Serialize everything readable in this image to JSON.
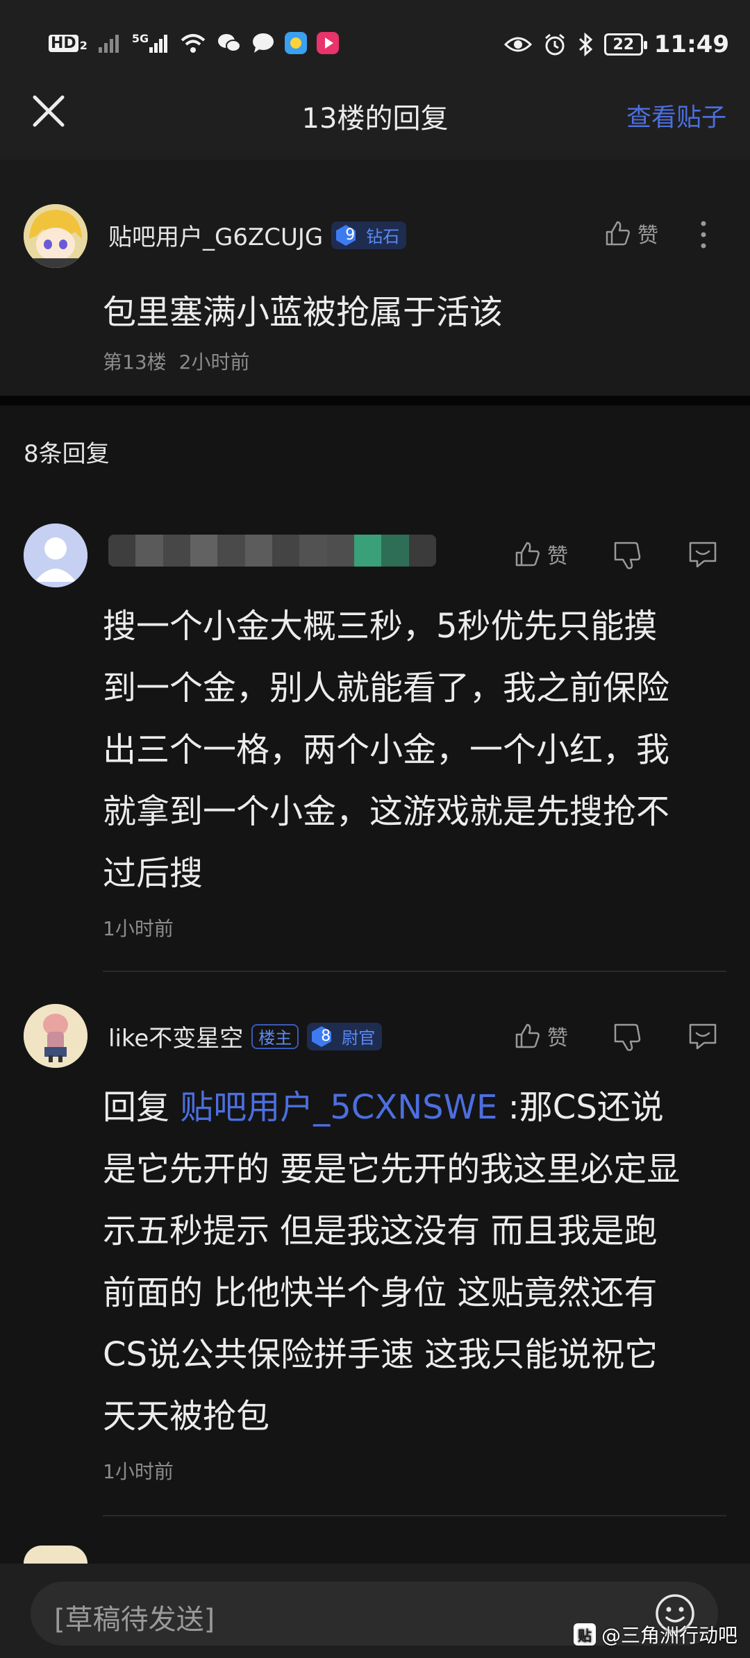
{
  "status_bar": {
    "hd_label": "HD",
    "hd_sub": "2",
    "net_label": "5G",
    "time": "11:49",
    "battery": "22"
  },
  "header": {
    "title": "13楼的回复",
    "view_post": "查看贴子"
  },
  "floor": {
    "username": "贴吧用户_G6ZCUJG",
    "level": "9",
    "level_title": "钻石",
    "like_label": "赞",
    "content": "包里塞满小蓝被抢属于活该",
    "floor_no": "第13楼",
    "time": "2小时前"
  },
  "replies_header": "8条回复",
  "replies": [
    {
      "username": "",
      "like_label": "赞",
      "lines": [
        "搜一个小金大概三秒，5秒优先只能摸",
        "到一个金，别人就能看了，我之前保险",
        "出三个一格，两个小金，一个小红，我",
        "就拿到一个小金，这游戏就是先搜抢不",
        "过后搜"
      ],
      "time": "1小时前"
    },
    {
      "username": "like不变星空",
      "owner_badge": "楼主",
      "level": "8",
      "level_title": "尉官",
      "like_label": "赞",
      "reply_prefix": "回复 ",
      "mention": "贴吧用户_5CXNSWE",
      "first_line_rest": " :那CS还说",
      "lines": [
        "是它先开的 要是它先开的我这里必定显",
        "示五秒提示 但是我这没有 而且我是跑",
        "前面的 比他快半个身位 这贴竟然还有",
        "CS说公共保险拼手速 这我只能说祝它",
        "天天被抢包"
      ],
      "time": "1小时前"
    }
  ],
  "bottom": {
    "draft_placeholder": "[草稿待发送]",
    "watermark_icon": "贴",
    "watermark_text": "@三角洲行动吧"
  },
  "colors": {
    "accent": "#4c6fe0",
    "background": "#141414",
    "badge_blue": "#5b8af5"
  }
}
